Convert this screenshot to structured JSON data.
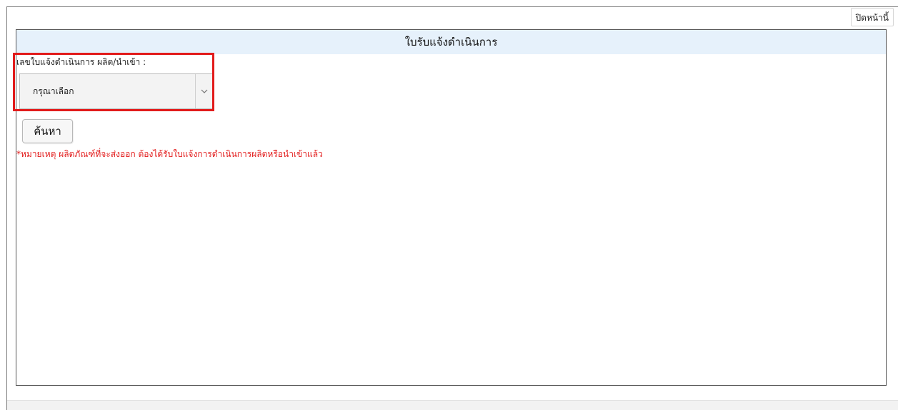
{
  "toolbar": {
    "close_label": "ปิดหน้านี้"
  },
  "panel": {
    "title": "ใบรับแจ้งดำเนินการ",
    "field_label": "เลขใบแจ้งดำเนินการ ผลิต/นำเข้า :",
    "select": {
      "selected": "กรุณาเลือก"
    },
    "search_label": "ค้นหา",
    "note": "*หมายเหตุ ผลิตภัณฑ์ที่จะส่งออก ต้องได้รับใบแจ้งการดำเนินการผลิตหรือนำเข้าแล้ว"
  },
  "colors": {
    "header_bg": "#e6f1fb",
    "highlight": "#e21b1b",
    "note": "#e21b1b"
  },
  "icons": {
    "select_arrow": "chevron-down-icon"
  }
}
